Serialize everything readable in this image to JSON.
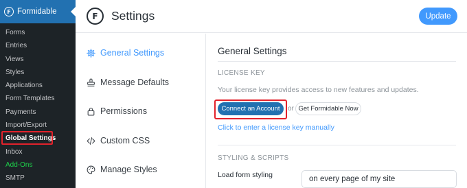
{
  "wp_sidebar": {
    "brand": "Formidable",
    "items": [
      "Forms",
      "Entries",
      "Views",
      "Styles",
      "Applications",
      "Form Templates",
      "Payments",
      "Import/Export",
      "Global Settings",
      "Inbox",
      "Add-Ons",
      "SMTP"
    ]
  },
  "header": {
    "logo_letter": "F",
    "title": "Settings",
    "update_label": "Update"
  },
  "nav": {
    "items": [
      {
        "label": "General Settings",
        "icon": "gear-icon"
      },
      {
        "label": "Message Defaults",
        "icon": "stamp-icon"
      },
      {
        "label": "Permissions",
        "icon": "lock-icon"
      },
      {
        "label": "Custom CSS",
        "icon": "code-icon"
      },
      {
        "label": "Manage Styles",
        "icon": "palette-icon"
      }
    ]
  },
  "content": {
    "title": "General Settings",
    "license_heading": "LICENSE KEY",
    "license_desc": "Your license key provides access to new features and updates.",
    "connect_label": "Connect an Account",
    "or_label": "or",
    "get_pro_label": "Get Formidable Now",
    "manual_link": "Click to enter a license key manually",
    "styling_heading": "STYLING & SCRIPTS",
    "load_label": "Load form styling",
    "load_value": "on every page of my site"
  },
  "colors": {
    "wp_sidebar_bg": "#1d2327",
    "wp_brand_bg": "#2271b1",
    "accent": "#4199fd",
    "highlight": "#e3222b",
    "addons_green": "#1ed14b"
  }
}
